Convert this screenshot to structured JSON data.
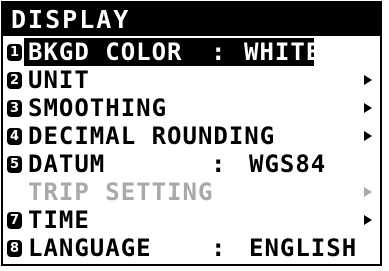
{
  "menu": {
    "title": "DISPLAY",
    "items": [
      {
        "number": "1",
        "label": "BKGD COLOR",
        "separator": ":",
        "value": "WHITE"
      },
      {
        "number": "2",
        "label": "UNIT"
      },
      {
        "number": "3",
        "label": "SMOOTHING"
      },
      {
        "number": "4",
        "label": "DECIMAL ROUNDING"
      },
      {
        "number": "5",
        "label": "DATUM",
        "separator": ":",
        "value": "WGS84"
      },
      {
        "label": "TRIP SETTING"
      },
      {
        "number": "7",
        "label": "TIME"
      },
      {
        "number": "8",
        "label": "LANGUAGE",
        "separator": ":",
        "value": "ENGLISH"
      }
    ],
    "selected_item": "BKGD COLOR",
    "disabled_item": "TRIP SETTING",
    "submenu_icon": "right-triangle-arrow",
    "colors": {
      "background": "#ffffff",
      "text": "#000000",
      "title_text": "#ffffff",
      "disabled": "#a9a9a9"
    }
  }
}
